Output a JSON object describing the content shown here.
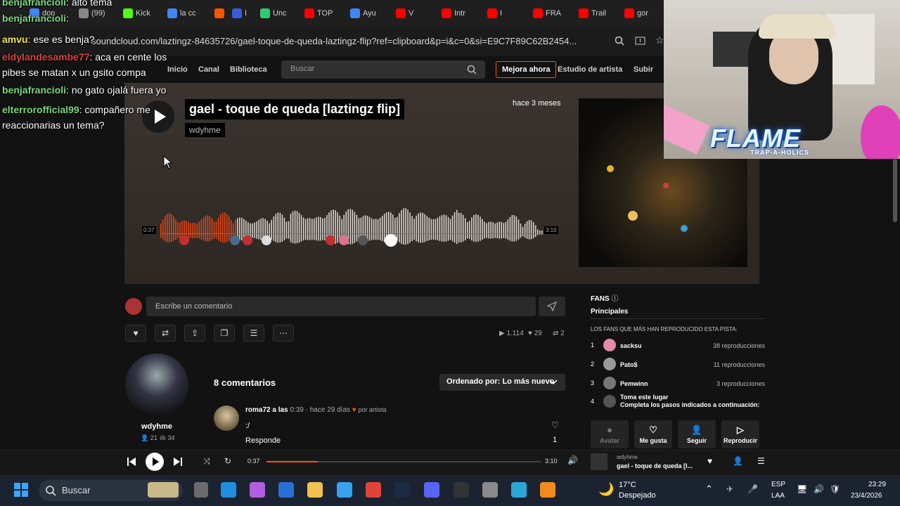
{
  "browser": {
    "tabs": [
      {
        "label": "don",
        "color": "#4285f4"
      },
      {
        "label": "(99)",
        "color": "#888888"
      },
      {
        "label": "Kick",
        "color": "#53fc18"
      },
      {
        "label": "la cc",
        "color": "#4285f4"
      },
      {
        "label": "",
        "color": "#ff5500"
      },
      {
        "label": "I",
        "color": "#3b5bdb"
      },
      {
        "label": "Unc",
        "color": "#2ecc71"
      },
      {
        "label": "TOP",
        "color": "#ff0000"
      },
      {
        "label": "Ayu",
        "color": "#4285f4"
      },
      {
        "label": "V",
        "color": "#ff0000"
      },
      {
        "label": "Intr",
        "color": "#ff0000"
      },
      {
        "label": "I",
        "color": "#ff0000"
      },
      {
        "label": "FRA",
        "color": "#ff0000"
      },
      {
        "label": "Trail",
        "color": "#ff0000"
      },
      {
        "label": "gor",
        "color": "#ff0000"
      }
    ],
    "url": "soundcloud.com/laztingz-84635726/gael-toque-de-queda-laztingz-flip?ref=clipboard&p=i&c=0&si=E9C7F89C62B2454..."
  },
  "soundcloud": {
    "nav": {
      "home": "Inicio",
      "channel": "Canal",
      "library": "Biblioteca",
      "search_placeholder": "Buscar",
      "upgrade": "Mejora ahora",
      "artist_studio": "Estudio de artista",
      "upload": "Subir"
    },
    "track": {
      "title": "gael - toque de queda [laztingz flip]",
      "artist": "wdyhme",
      "posted": "hace 3 meses",
      "current_time": "0:37",
      "duration": "3:10",
      "progress": 0.195
    },
    "comment_box": {
      "placeholder": "Escribe un comentario"
    },
    "stats": {
      "plays": "1.114",
      "likes": "29",
      "reposts": "2"
    },
    "artist_panel": {
      "name": "wdyhme",
      "followers": "21",
      "tracks": "34"
    },
    "comments": {
      "count_label": "8 comentarios",
      "sort_label": "Ordenado por: Lo más nuevo",
      "items": [
        {
          "user": "roma72 a las",
          "time": "0:39",
          "ago": "· hace 29 días",
          "badge": "por artista",
          "text": ":/",
          "reply": "Responde",
          "likes": "1"
        }
      ]
    },
    "fans": {
      "title": "FANS",
      "tab": "Principales",
      "subtitle": "LOS FANS QUE MÁS HAN REPRODUCIDO ESTA PISTA:",
      "rows": [
        {
          "rank": "1",
          "name": "sacksu",
          "plays": "38 reproducciones",
          "color": "#e58aa8"
        },
        {
          "rank": "2",
          "name": "Pato$",
          "plays": "11 reproducciones",
          "color": "#999999"
        },
        {
          "rank": "3",
          "name": "Pemwinn",
          "plays": "3 reproducciones",
          "color": "#777777"
        },
        {
          "rank": "4",
          "name": "Toma este lugar",
          "plays": "Completa los pasos indicados a continuación:",
          "color": "#555555"
        }
      ],
      "buttons": {
        "avatar": "Avatar",
        "like": "Me gusta",
        "follow": "Seguir",
        "play": "Reproducir"
      }
    },
    "player": {
      "current": "0:37",
      "duration": "3:10",
      "artist": "wdyhme",
      "title": "gael - toque de queda [l..."
    }
  },
  "chat": [
    {
      "user": "benjafrancioli",
      "color": "#7fd67f",
      "text": "alto tema"
    },
    {
      "user": "benjafrancioli",
      "color": "#7fd67f",
      "text": ""
    },
    {
      "user": "amvu",
      "color": "#f2e14d",
      "text": "ese es benja?"
    },
    {
      "user": "eldylandesambe77",
      "color": "#e04040",
      "text": "aca en cente los"
    },
    {
      "user": "",
      "color": "#ffffff",
      "text": "pibes se matan x un gsito compa"
    },
    {
      "user": "benjafrancioli",
      "color": "#7fd67f",
      "text": "no gato ojalá fuera yo"
    },
    {
      "user": "elterrorofficial99",
      "color": "#7fd67f",
      "text": "compañero me"
    },
    {
      "user": "",
      "color": "#ffffff",
      "text": "reaccionarias un tema?"
    }
  ],
  "overlay": {
    "title": "FLAME",
    "subtitle": "TRAP-A-HOLICS"
  },
  "taskbar": {
    "search": "Buscar",
    "weather_temp": "17°C",
    "weather_text": "Despejado",
    "lang1": "ESP",
    "lang2": "LAA",
    "time": "23:29",
    "date": "23/4/2026"
  }
}
